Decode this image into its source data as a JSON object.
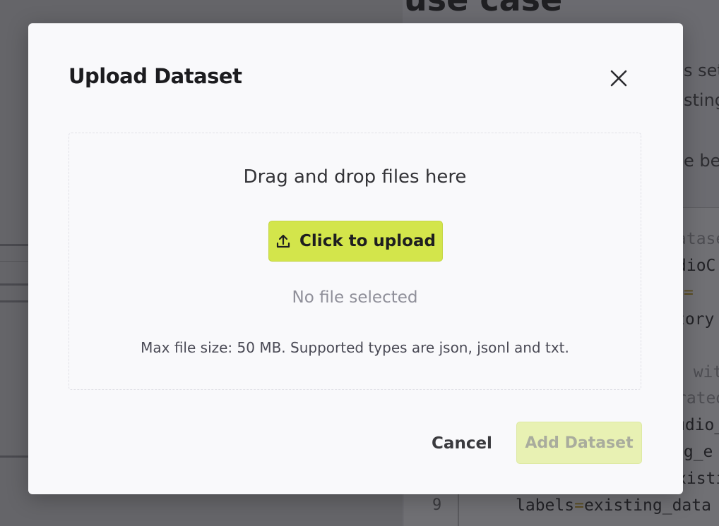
{
  "background": {
    "heading": "use case",
    "text_fragments": [
      "s set",
      "sting",
      "e be"
    ],
    "code_lines": [
      {
        "segments": [
          {
            "text": "atase",
            "faint": true
          }
        ]
      },
      {
        "segments": [
          {
            "text": "dioC"
          }
        ]
      },
      {
        "segments": [
          {
            "text": "=",
            "op": true
          }
        ]
      },
      {
        "segments": [
          {
            "text": "tory"
          }
        ]
      },
      {
        "segments": [
          {
            "text": ": wit",
            "faint": true
          }
        ]
      },
      {
        "segments": [
          {
            "text": "rated",
            "faint": true
          }
        ]
      },
      {
        "segments": [
          {
            "text": "udio_"
          }
        ]
      },
      {
        "segments": [
          {
            "text": "ng_e"
          }
        ]
      },
      {
        "segments": [
          {
            "text": "xisti"
          }
        ]
      },
      {
        "segments": [
          {
            "text": "labels"
          },
          {
            "text": "=",
            "op": true
          },
          {
            "text": "existing_data"
          }
        ]
      }
    ],
    "line_number": "9"
  },
  "modal": {
    "title": "Upload Dataset",
    "close_icon": "close-icon",
    "dropzone": {
      "label": "Drag and drop files here",
      "upload_button_label": "Click to upload",
      "upload_icon": "upload-icon",
      "status": "No file selected",
      "hint": "Max file size: 50 MB. Supported types are json, jsonl and txt."
    },
    "footer": {
      "cancel_label": "Cancel",
      "add_label": "Add Dataset",
      "add_enabled": false
    }
  },
  "colors": {
    "accent": "#d3e54b",
    "accent_disabled": "#e8f1b3",
    "overlay": "#6b6b70"
  }
}
